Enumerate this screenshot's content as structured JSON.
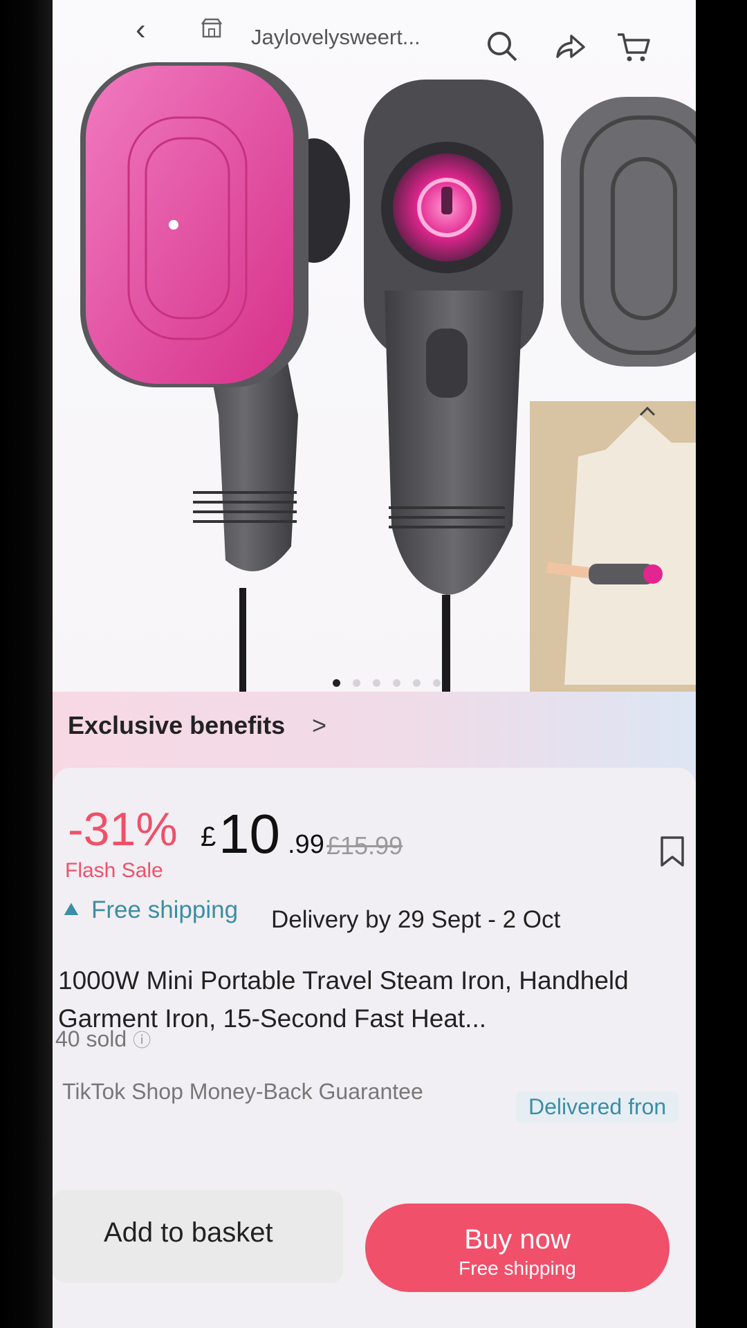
{
  "header": {
    "back_icon": "chevron-left-icon",
    "shop_name": "Jaylovelysweert...",
    "icons": [
      "search-icon",
      "share-icon",
      "cart-icon"
    ]
  },
  "gallery": {
    "images": [
      "steam-iron-pink-pad",
      "steam-iron-front",
      "steam-iron-base",
      "shirt-being-steamed"
    ],
    "active_index": 0,
    "dot_count": 6
  },
  "benefits": {
    "label": "Exclusive benefits",
    "chevron": ">"
  },
  "price": {
    "discount": "-31%",
    "currency": "£",
    "main": "10",
    "decimal": ".99",
    "original": "£15.99",
    "flash_label": "Flash Sale"
  },
  "shipping": {
    "free_label": "Free shipping",
    "delivery": "Delivery by 29 Sept - 2 Oct"
  },
  "product": {
    "title": "1000W Mini Portable Travel Steam Iron, Handheld Garment Iron, 15-Second Fast Heat...",
    "sold": "40 sold"
  },
  "badges": {
    "guarantee": "TikTok Shop Money-Back Guarantee",
    "delivered_from": "Delivered fron"
  },
  "actions": {
    "add_to_basket": "Add to basket",
    "buy_now": "Buy now",
    "buy_now_sub": "Free shipping"
  },
  "colors": {
    "accent": "#f0506a",
    "shipping": "#3b8ea5",
    "product_pink": "#e8358f",
    "product_grey": "#5a5a5e"
  }
}
